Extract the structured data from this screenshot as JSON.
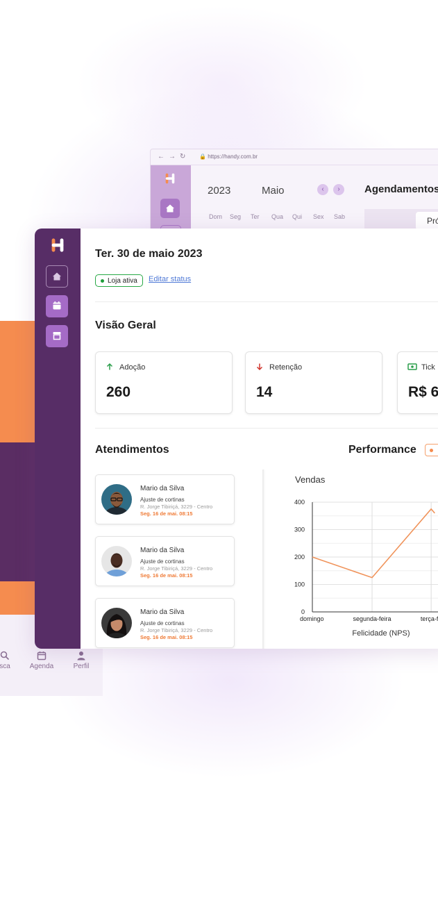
{
  "phone": {
    "nav": [
      {
        "label": "sca",
        "icon": "search-icon"
      },
      {
        "label": "Agenda",
        "icon": "calendar-icon"
      },
      {
        "label": "Perfil",
        "icon": "user-icon"
      }
    ]
  },
  "browser": {
    "url": "https://handy.com.br",
    "year": "2023",
    "month": "Maio",
    "weekdays": [
      "Dom",
      "Seg",
      "Ter",
      "Qua",
      "Qui",
      "Sex",
      "Sab"
    ],
    "section_title": "Agendamentos",
    "next_button": "Pró"
  },
  "header": {
    "date": "Ter. 30 de maio 2023",
    "status_badge": "Loja ativa",
    "edit_link": "Editar status"
  },
  "overview": {
    "title": "Visão Geral",
    "stats": [
      {
        "label": "Adoção",
        "value": "260",
        "icon": "arrow-up-icon"
      },
      {
        "label": "Retenção",
        "value": "14",
        "icon": "arrow-down-icon"
      },
      {
        "label": "Tick",
        "value": "R$ 6",
        "icon": "money-icon"
      }
    ]
  },
  "appointments": {
    "title": "Atendimentos",
    "items": [
      {
        "name": "Mario da Silva",
        "service": "Ajuste de cortinas",
        "address": "R. Jorge Tibiriçá, 3229 - Centro",
        "time": "Seg. 16 de mai. 08:15"
      },
      {
        "name": "Mario da Silva",
        "service": "Ajuste de cortinas",
        "address": "R. Jorge Tibiriçá, 3229 - Centro",
        "time": "Seg. 16 de mai. 08:15"
      },
      {
        "name": "Mario da Silva",
        "service": "Ajuste de cortinas",
        "address": "R. Jorge Tibiriçá, 3229 - Centro",
        "time": "Seg. 16 de mai. 08:15"
      }
    ]
  },
  "performance": {
    "title": "Performance",
    "colors": {
      "line": "#f0935a",
      "accent": "#f58c4f",
      "sidebar": "#572d66"
    }
  },
  "chart_data": {
    "type": "line",
    "title": "Vendas",
    "xlabel": "Felicidade (NPS)",
    "ylabel": "",
    "categories": [
      "domingo",
      "segunda-feira",
      "terça-fe"
    ],
    "x_positions": [
      0,
      1,
      1.99
    ],
    "values": [
      200,
      125,
      375
    ],
    "extra_point": {
      "x": 2.05,
      "y": 360
    },
    "yticks": [
      0,
      100,
      200,
      300,
      400
    ],
    "ylim": [
      0,
      400
    ],
    "grid": true
  }
}
